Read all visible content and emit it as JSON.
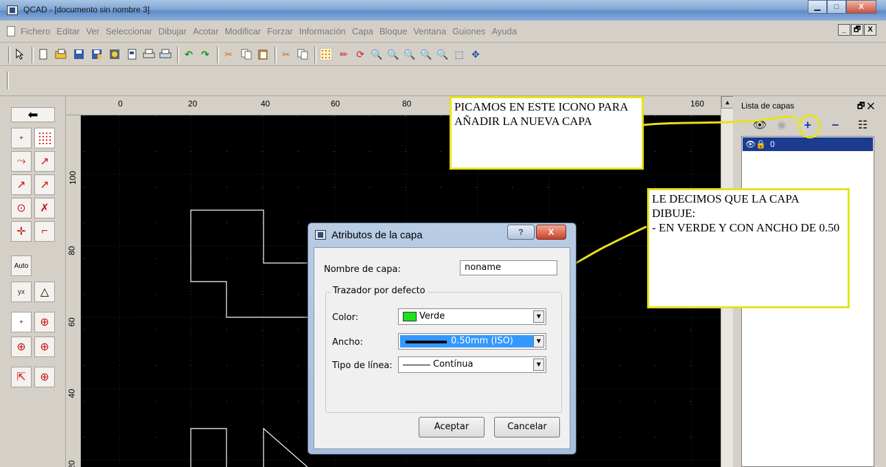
{
  "window": {
    "title": "QCAD - [documento sin nombre 3]",
    "minimize": "▁",
    "maximize": "□",
    "close": "X"
  },
  "menu": [
    "Fichero",
    "Editar",
    "Ver",
    "Seleccionar",
    "Dibujar",
    "Acotar",
    "Modificar",
    "Forzar",
    "Información",
    "Capa",
    "Bloque",
    "Ventana",
    "Guiones",
    "Ayuda"
  ],
  "mdi": {
    "minimize": "_",
    "restore": "🗗",
    "close": "X"
  },
  "toolbar_icons": [
    "pointer-icon",
    "new-file-icon",
    "open-icon",
    "save-icon",
    "save-as-icon",
    "insert-icon",
    "print-preview-icon",
    "print-icon",
    "print-setup-icon",
    "undo-icon",
    "redo-icon",
    "cut-icon",
    "copy-icon",
    "paste-icon",
    "cut-ref-icon",
    "copy-ref-icon",
    "grid-icon",
    "draft-icon",
    "redraw-icon",
    "zoom-in-icon",
    "zoom-out-icon",
    "zoom-auto-icon",
    "zoom-prev-icon",
    "zoom-window-icon",
    "zoom-pan-icon"
  ],
  "left_tools": {
    "back": "⬅",
    "auto_label": "Auto"
  },
  "ruler": {
    "h_ticks": [
      "0",
      "20",
      "40",
      "60",
      "80",
      "160"
    ],
    "v_ticks": [
      "100",
      "80",
      "60",
      "40",
      "20"
    ]
  },
  "callouts": {
    "add_layer": "PICAMOS EN ESTE ICONO PARA AÑADIR LA NUEVA CAPA",
    "attributes": "LE DECIMOS QUE LA CAPA DIBUJE:\n- EN VERDE Y CON ANCHO DE 0.50"
  },
  "layer_panel": {
    "title": "Lista de capas",
    "header_btns": "🗗 ✕",
    "tools": {
      "show": "👁",
      "hide": "◉",
      "add": "+",
      "remove": "−",
      "edit": "☷"
    },
    "layers": [
      {
        "name": "0",
        "icons": "👁🔒"
      }
    ]
  },
  "dialog": {
    "title": "Atributos de la capa",
    "help": "?",
    "close": "X",
    "name_label": "Nombre de capa:",
    "name_value": "noname",
    "group_label": "Trazador por defecto",
    "color_label": "Color:",
    "color_value": "Verde",
    "color_hex": "#1ee01e",
    "width_label": "Ancho:",
    "width_value": "0.50mm (ISO)",
    "linetype_label": "Tipo de línea:",
    "linetype_value": "Contínua",
    "ok": "Aceptar",
    "cancel": "Cancelar"
  },
  "colors": {
    "highlight": "#e8e21a",
    "selection": "#1a3b8f",
    "canvas": "#000000"
  }
}
